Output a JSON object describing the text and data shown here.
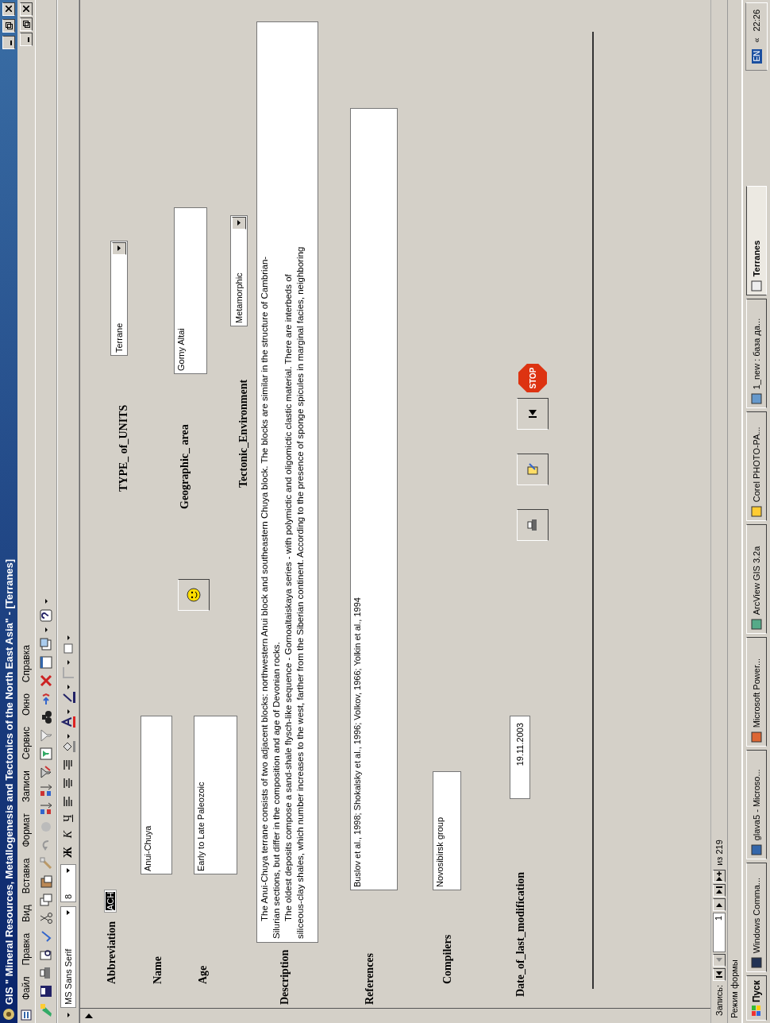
{
  "window": {
    "title": "GIS \" Mineral Resources, Metallogenesis and Tectonics of the North East Asia\" - [Terranes]"
  },
  "menu": [
    "Файл",
    "Правка",
    "Вид",
    "Вставка",
    "Формат",
    "Записи",
    "Сервис",
    "Окно",
    "Справка"
  ],
  "format_toolbar": {
    "font_name": "MS Sans Serif",
    "font_size": "8",
    "style_buttons": [
      "Ж",
      "К",
      "Ч"
    ]
  },
  "form": {
    "abbreviation": {
      "label": "Abbreviation",
      "value": "ACH",
      "highlighted": true
    },
    "name": {
      "label": "Name",
      "value": "Anui-Chuya"
    },
    "age": {
      "label": "Age",
      "value": "Early to Late Paleozoic"
    },
    "type_of_units": {
      "label": "TYPE_ of_UNITS",
      "value": "Terrane"
    },
    "geographic_area": {
      "label": "Geographic_ area",
      "value": "Gorny Altai"
    },
    "tectonic_environment": {
      "label": "Tectonic_Environment",
      "value": "Metamorphic"
    },
    "description": {
      "label": "Description",
      "lines": [
        {
          "text": "The Anui-Chuya terrane consists of two adjacent blocks: northwestern Anui block  and southeastern Chuya block. The blocks are similar in the structure of Cambrian-",
          "indent": true
        },
        {
          "text": "Silurian sections, but differ in the composition and age of Devonian rocks.",
          "indent": false
        },
        {
          "text": "The oldest deposits compose a sand-shale flysch-like sequence - Gornoaltaiskaya series - with polymictic and oligomictic clastic material. There are interbeds of",
          "indent": true
        },
        {
          "text": "siliceous-clay shales, which number increases to the west, farther from the Siberian continent. According to the presence of sponge spicules in marginal facies, neighboring",
          "indent": false
        }
      ]
    },
    "references": {
      "label": "References",
      "value": "Buslov et al., 1998; Shokalsky et al., 1996; Volkov, 1966; Yolkin et al., 1994"
    },
    "compilers": {
      "label": "Compilers",
      "value": "Novosibirsk group"
    },
    "date": {
      "label": "Date_of_last_modification",
      "value": "19.11.2003"
    },
    "stop_label": "STOP"
  },
  "record_nav": {
    "label": "Запись:",
    "current": "1",
    "total": "из 219"
  },
  "status_bar": "Режим формы",
  "taskbar": {
    "start": "Пуск",
    "tasks": [
      {
        "label": "Windows Comma...",
        "selected": false
      },
      {
        "label": "glava5 - Microso...",
        "selected": false
      },
      {
        "label": "Microsoft Power...",
        "selected": false
      },
      {
        "label": "ArcView GIS 3.2a",
        "selected": false
      },
      {
        "label": "Corel PHOTO-PA...",
        "selected": false
      },
      {
        "label": "1_new : база да...",
        "selected": false
      },
      {
        "label": "Terranes",
        "selected": true
      }
    ],
    "language": "EN",
    "expand": "«",
    "clock": "22:26"
  }
}
